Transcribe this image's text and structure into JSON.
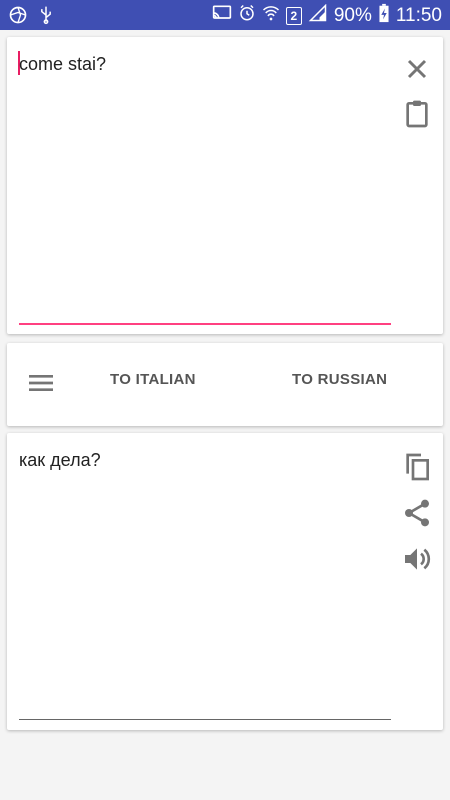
{
  "status_bar": {
    "battery": "90%",
    "time": "11:50",
    "sim_badge": "2",
    "icons": [
      "aperture-icon",
      "usb-icon",
      "cast-icon",
      "alarm-icon",
      "wifi-icon",
      "signal-icon",
      "battery-charging-icon"
    ]
  },
  "input": {
    "text": "come stai?",
    "icons": [
      "close-icon",
      "clipboard-icon"
    ]
  },
  "actions": {
    "menu_icon": "menu-icon",
    "to_italian": "TO ITALIAN",
    "to_russian": "TO RUSSIAN"
  },
  "output": {
    "text": "как дела?",
    "icons": [
      "copy-icon",
      "share-icon",
      "volume-icon"
    ]
  },
  "colors": {
    "status_bar": "#3f4fb3",
    "accent": "#ff4081",
    "icon": "#757575"
  }
}
